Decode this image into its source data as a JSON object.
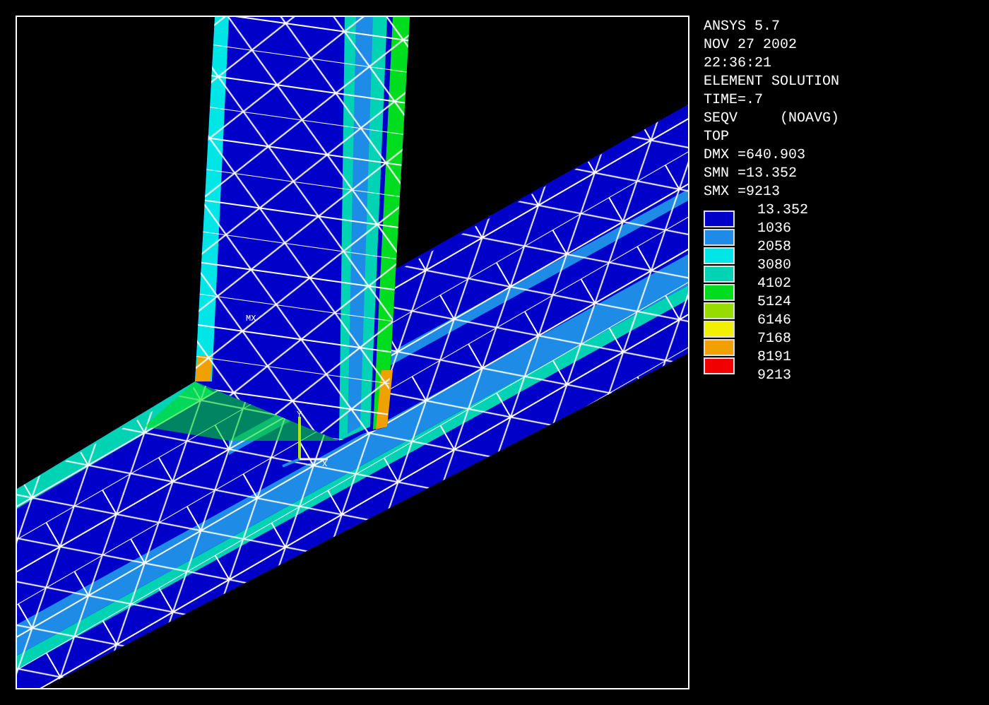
{
  "plot": {
    "node_label": "MX",
    "triad": {
      "y_label": "Y",
      "x_label": "X"
    }
  },
  "info_lines": [
    "ANSYS 5.7",
    "NOV 27 2002",
    "22:36:21",
    "ELEMENT SOLUTION",
    "TIME=.7",
    "SEQV     (NOAVG)",
    "TOP",
    "DMX =640.903",
    "SMN =13.352",
    "SMX =9213"
  ],
  "legend": {
    "values": [
      "13.352",
      "1036",
      "2058",
      "3080",
      "4102",
      "5124",
      "6146",
      "7168",
      "8191",
      "9213"
    ],
    "bands": [
      {
        "color": "#0000c8"
      },
      {
        "color": "#1e8ce6"
      },
      {
        "color": "#00e6e6"
      },
      {
        "color": "#00d2b4"
      },
      {
        "color": "#00dc1e"
      },
      {
        "color": "#96dc00"
      },
      {
        "color": "#f0f000"
      },
      {
        "color": "#f0a000"
      },
      {
        "color": "#f00000"
      }
    ]
  }
}
